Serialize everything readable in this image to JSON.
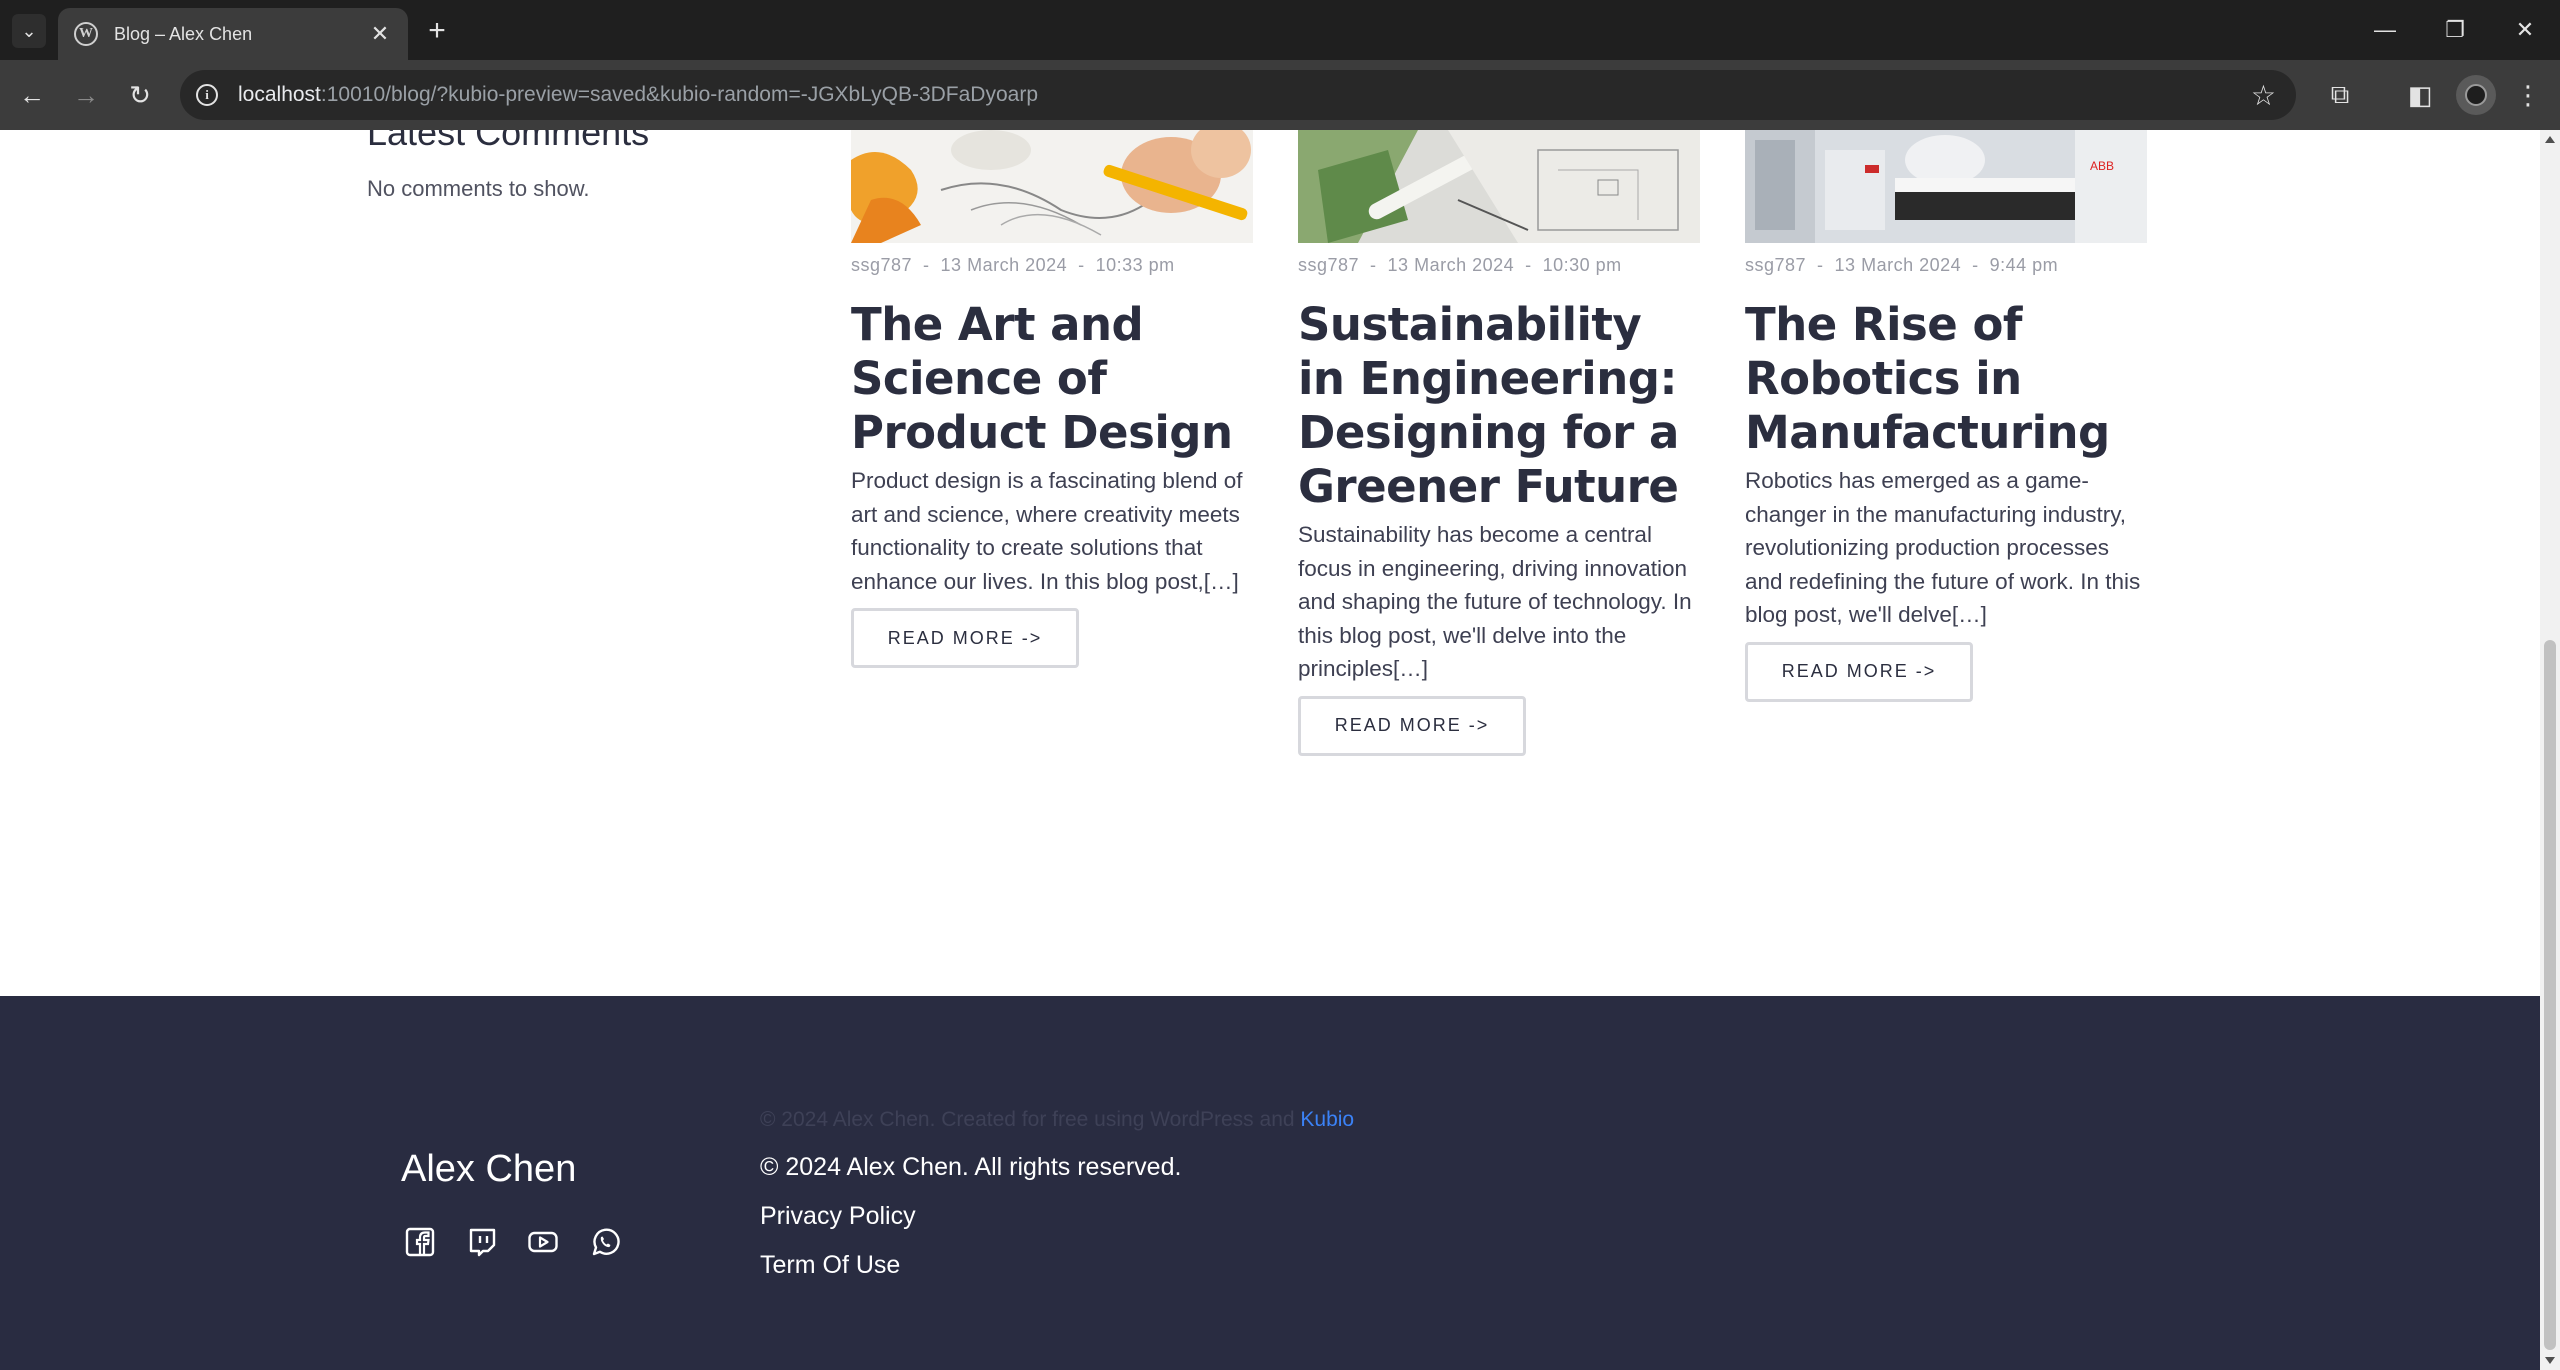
{
  "browser": {
    "tab_title": "Blog – Alex Chen",
    "url_host": "localhost",
    "url_rest": ":10010/blog/?kubio-preview=saved&kubio-random=-JGXbLyQB-3DFaDyoarp"
  },
  "sidebar": {
    "heading": "Latest Comments",
    "empty_text": "No comments to show."
  },
  "posts": [
    {
      "author": "ssg787",
      "date": "13 March 2024",
      "time": "10:33 pm",
      "title": "The Art and Science of Product Design",
      "excerpt": "Product design is a fascinating blend of art and science, where creativity meets functionality to create solutions that enhance our lives. In this blog post,[…]",
      "button": "READ MORE ->"
    },
    {
      "author": "ssg787",
      "date": "13 March 2024",
      "time": "10:30 pm",
      "title": "Sustainability in Engineering: Designing for a Greener Future",
      "excerpt": "Sustainability has become a central focus in engineering, driving innovation and shaping the future of technology. In this blog post, we'll delve into the principles[…]",
      "button": "READ MORE ->"
    },
    {
      "author": "ssg787",
      "date": "13 March 2024",
      "time": "9:44 pm",
      "title": "The Rise of Robotics in Manufacturing",
      "excerpt": "Robotics has emerged as a game-changer in the manufacturing industry, revolutionizing production processes and redefining the future of work. In this blog post, we'll delve[…]",
      "button": "READ MORE ->"
    }
  ],
  "footer": {
    "credit_prefix": "© 2024 Alex Chen. Created for free using WordPress and ",
    "credit_link": "Kubio",
    "brand": "Alex Chen",
    "copyright": "© 2024 Alex Chen. All rights reserved.",
    "links": [
      "Privacy Policy",
      "Term Of Use"
    ],
    "social_icons": [
      "facebook-icon",
      "twitch-icon",
      "youtube-icon",
      "whatsapp-icon"
    ]
  },
  "colors": {
    "footer_bg": "#292c41",
    "heading": "#2b2e3f",
    "link_accent": "#3b82f6"
  }
}
